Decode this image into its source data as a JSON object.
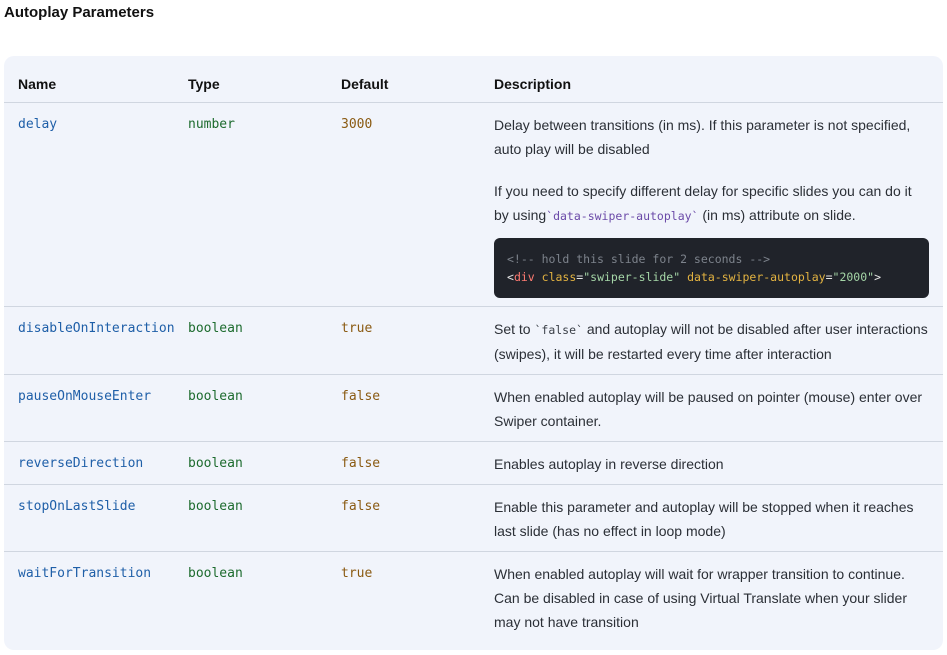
{
  "section_title": "Autoplay Parameters",
  "table": {
    "headers": {
      "name": "Name",
      "type": "Type",
      "default": "Default",
      "description": "Description"
    },
    "rows": [
      {
        "name": "delay",
        "type": "number",
        "default": "3000",
        "desc1": "Delay between transitions (in ms). If this parameter is not specified, auto play will be disabled",
        "desc2_pre": "If you need to specify different delay for specific slides you can do it by using",
        "desc2_code": "`data-swiper-autoplay`",
        "desc2_post": " (in ms) attribute on slide.",
        "code": {
          "comment": "<!-- hold this slide for 2 seconds -->",
          "open": "<",
          "tag": "div",
          "attr1": "class",
          "eq1": "=",
          "val1": "\"swiper-slide\"",
          "attr2": "data-swiper-autoplay",
          "eq2": "=",
          "val2": "\"2000\"",
          "close": ">"
        }
      },
      {
        "name": "disableOnInteraction",
        "type": "boolean",
        "default": "true",
        "desc_pre": "Set to ",
        "desc_code": "`false`",
        "desc_post": " and autoplay will not be disabled after user interactions (swipes), it will be restarted every time after interaction"
      },
      {
        "name": "pauseOnMouseEnter",
        "type": "boolean",
        "default": "false",
        "desc": "When enabled autoplay will be paused on pointer (mouse) enter over Swiper container."
      },
      {
        "name": "reverseDirection",
        "type": "boolean",
        "default": "false",
        "desc": "Enables autoplay in reverse direction"
      },
      {
        "name": "stopOnLastSlide",
        "type": "boolean",
        "default": "false",
        "desc": "Enable this parameter and autoplay will be stopped when it reaches last slide (has no effect in loop mode)"
      },
      {
        "name": "waitForTransition",
        "type": "boolean",
        "default": "true",
        "desc": "When enabled autoplay will wait for wrapper transition to continue. Can be disabled in case of using Virtual Translate when your slider may not have transition"
      }
    ]
  }
}
